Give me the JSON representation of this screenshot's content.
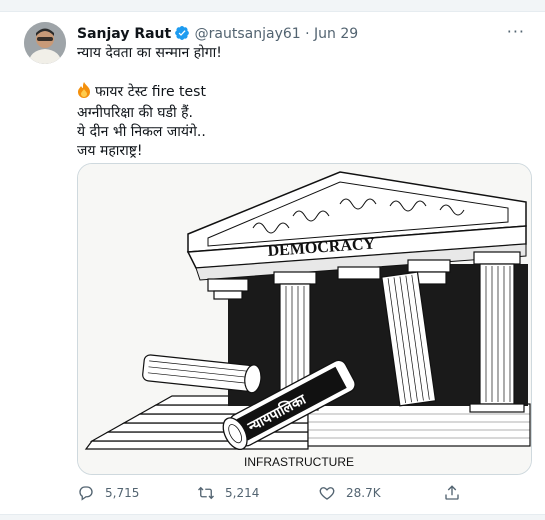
{
  "tweet": {
    "author_name": "Sanjay Raut",
    "handle": "@rautsanjay61",
    "separator": "·",
    "date": "Jun 29",
    "more_label": "···",
    "lines": [
      "न्याय देवता का सन्मान होगा!",
      "फायर टेस्ट fire test",
      "अग्नीपरिक्षा की घडी हैं.",
      "ये दीन भी निकल जायंगे..",
      "जय महाराष्ट्र!"
    ]
  },
  "media": {
    "cartoon_texts": {
      "pediment": "DEMOCRACY",
      "fallen_pillar": "न्यायपालिका",
      "base": "INFRASTRUCTURE"
    }
  },
  "actions": {
    "reply_count": "5,715",
    "retweet_count": "5,214",
    "like_count": "28.7K"
  },
  "colors": {
    "text": "#0f1419",
    "secondary": "#536471",
    "verified": "#1d9bf0",
    "border": "#cfd9de"
  },
  "icons": [
    "verified-badge-icon",
    "more-icon",
    "fire-emoji-icon",
    "reply-icon",
    "retweet-icon",
    "like-icon",
    "share-icon"
  ]
}
